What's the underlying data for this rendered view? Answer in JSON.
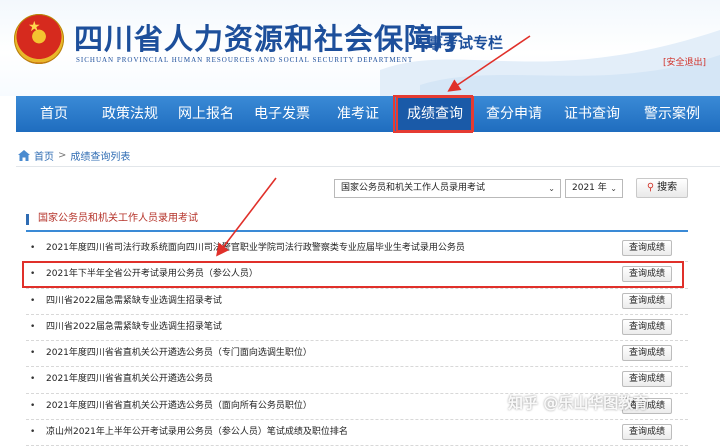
{
  "header": {
    "title": "四川省人力资源和社会保障厅",
    "subtitle": "SICHUAN PROVINCIAL HUMAN RESOURCES AND SOCIAL SECURITY DEPARTMENT",
    "column": "人事考试专栏",
    "safe_exit": "[安全退出]"
  },
  "nav": {
    "items": [
      {
        "label": "首页"
      },
      {
        "label": "政策法规"
      },
      {
        "label": "网上报名"
      },
      {
        "label": "电子发票"
      },
      {
        "label": "准考证"
      },
      {
        "label": "成绩查询",
        "active": true
      },
      {
        "label": "查分申请"
      },
      {
        "label": "证书查询"
      },
      {
        "label": "警示案例"
      }
    ]
  },
  "breadcrumb": {
    "home": "首页",
    "separator": ">",
    "current": "成绩查询列表"
  },
  "filters": {
    "exam_select": "国家公务员和机关工作人员录用考试",
    "year_select": "2021 年",
    "search_button": "搜索"
  },
  "section": {
    "title": "国家公务员和机关工作人员录用考试"
  },
  "list": {
    "button_label": "查询成绩",
    "items": [
      {
        "title": "2021年度四川省司法行政系统面向四川司法警官职业学院司法行政警察类专业应届毕业生考试录用公务员"
      },
      {
        "title": "2021年下半年全省公开考试录用公务员（参公人员）",
        "highlighted": true
      },
      {
        "title": "四川省2022届急需紧缺专业选调生招录考试"
      },
      {
        "title": "四川省2022届急需紧缺专业选调生招录笔试"
      },
      {
        "title": "2021年度四川省省直机关公开遴选公务员（专门面向选调生职位）"
      },
      {
        "title": "2021年度四川省省直机关公开遴选公务员"
      },
      {
        "title": "2021年度四川省省直机关公开遴选公务员（面向所有公务员职位）"
      },
      {
        "title": "凉山州2021年上半年公开考试录用公务员（参公人员）笔试成绩及职位排名"
      }
    ]
  },
  "watermark": "知乎 @乐山华图教育",
  "colors": {
    "nav_bg": "#1f6dbf",
    "highlight": "#e0302a",
    "title_blue": "#1d4f9b"
  }
}
